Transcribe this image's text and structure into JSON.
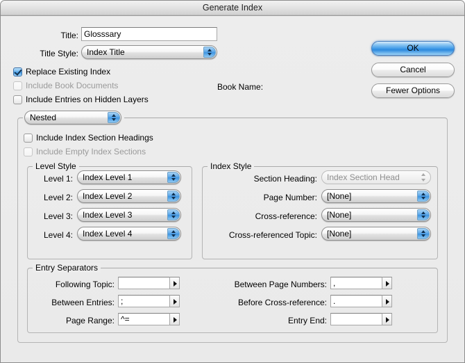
{
  "window": {
    "title": "Generate Index"
  },
  "header": {
    "title_label": "Title:",
    "title_value": "Glosssary",
    "title_style_label": "Title Style:",
    "title_style_value": "Index Title",
    "book_name_label": "Book Name:",
    "book_name_value": ""
  },
  "buttons": {
    "ok": "OK",
    "cancel": "Cancel",
    "fewer_options": "Fewer Options"
  },
  "checkboxes": {
    "replace_existing_index": {
      "label": "Replace Existing Index",
      "checked": true,
      "enabled": true
    },
    "include_book_documents": {
      "label": "Include Book Documents",
      "checked": false,
      "enabled": false
    },
    "include_entries_hidden_layers": {
      "label": "Include Entries on Hidden Layers",
      "checked": false,
      "enabled": true
    },
    "include_index_section_headings": {
      "label": "Include Index Section Headings",
      "checked": false,
      "enabled": true
    },
    "include_empty_index_sections": {
      "label": "Include Empty Index Sections",
      "checked": false,
      "enabled": false
    }
  },
  "format_popup": {
    "value": "Nested"
  },
  "level_style": {
    "group_title": "Level Style",
    "rows": [
      {
        "label": "Level 1:",
        "value": "Index Level 1"
      },
      {
        "label": "Level 2:",
        "value": "Index Level 2"
      },
      {
        "label": "Level 3:",
        "value": "Index Level 3"
      },
      {
        "label": "Level 4:",
        "value": "Index Level 4"
      }
    ]
  },
  "index_style": {
    "group_title": "Index Style",
    "rows": [
      {
        "label": "Section Heading:",
        "value": "Index Section Head",
        "enabled": false
      },
      {
        "label": "Page Number:",
        "value": "[None]",
        "enabled": true
      },
      {
        "label": "Cross-reference:",
        "value": "[None]",
        "enabled": true
      },
      {
        "label": "Cross-referenced Topic:",
        "value": "[None]",
        "enabled": true
      }
    ]
  },
  "entry_separators": {
    "group_title": "Entry Separators",
    "left": [
      {
        "label": "Following Topic:",
        "value": ""
      },
      {
        "label": "Between Entries:",
        "value": ";"
      },
      {
        "label": "Page Range:",
        "value": "^="
      }
    ],
    "right": [
      {
        "label": "Between Page Numbers:",
        "value": ","
      },
      {
        "label": "Before Cross-reference:",
        "value": "."
      },
      {
        "label": "Entry End:",
        "value": ""
      }
    ]
  },
  "colors": {
    "accent": "#3f9ae8",
    "window_bg": "#ededed",
    "titlebar": "#e4e4e4"
  }
}
